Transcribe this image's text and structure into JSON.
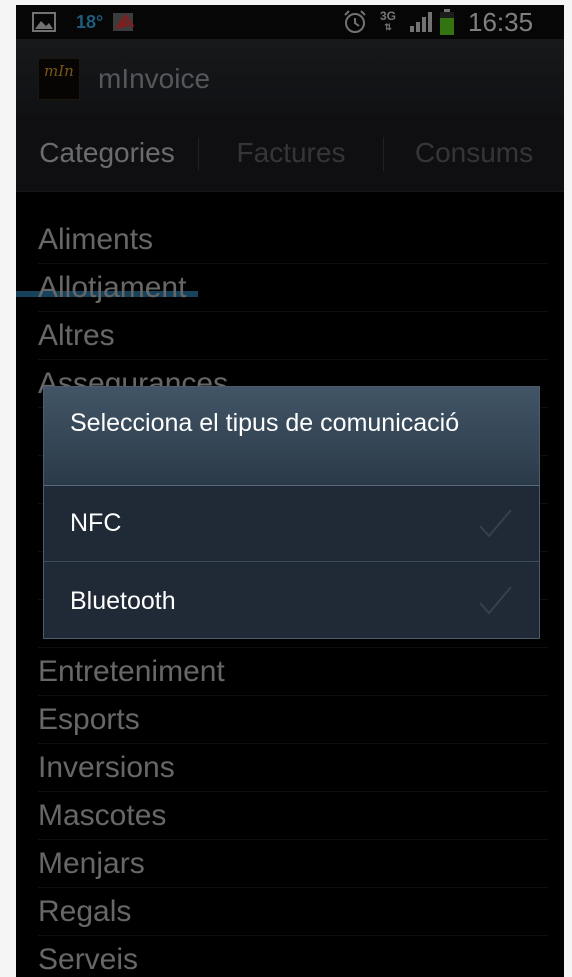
{
  "status_bar": {
    "temperature": "18°",
    "network": "3G",
    "time": "16:35",
    "icons": [
      "gallery-icon",
      "weather-flag-icon",
      "alarm-icon",
      "signal-icon",
      "battery-icon"
    ]
  },
  "action_bar": {
    "logo_text": "mIn",
    "title": "mInvoice"
  },
  "tabs": [
    {
      "label": "Categories",
      "active": true
    },
    {
      "label": "Factures",
      "active": false
    },
    {
      "label": "Consums",
      "active": false
    }
  ],
  "categories": [
    "Aliments",
    "Allotjament",
    "Altres",
    "Assegurances",
    "",
    "",
    "",
    "",
    "",
    "Entreteniment",
    "Esports",
    "Inversions",
    "Mascotes",
    "Menjars",
    "Regals",
    "Serveis"
  ],
  "dialog": {
    "title": "Selecciona el tipus de comunicació",
    "options": [
      {
        "label": "NFC"
      },
      {
        "label": "Bluetooth"
      }
    ]
  },
  "colors": {
    "accent_tab": "#2a78a8",
    "dialog_bg": "#1f2a36",
    "logo_text": "#e19a2b"
  }
}
